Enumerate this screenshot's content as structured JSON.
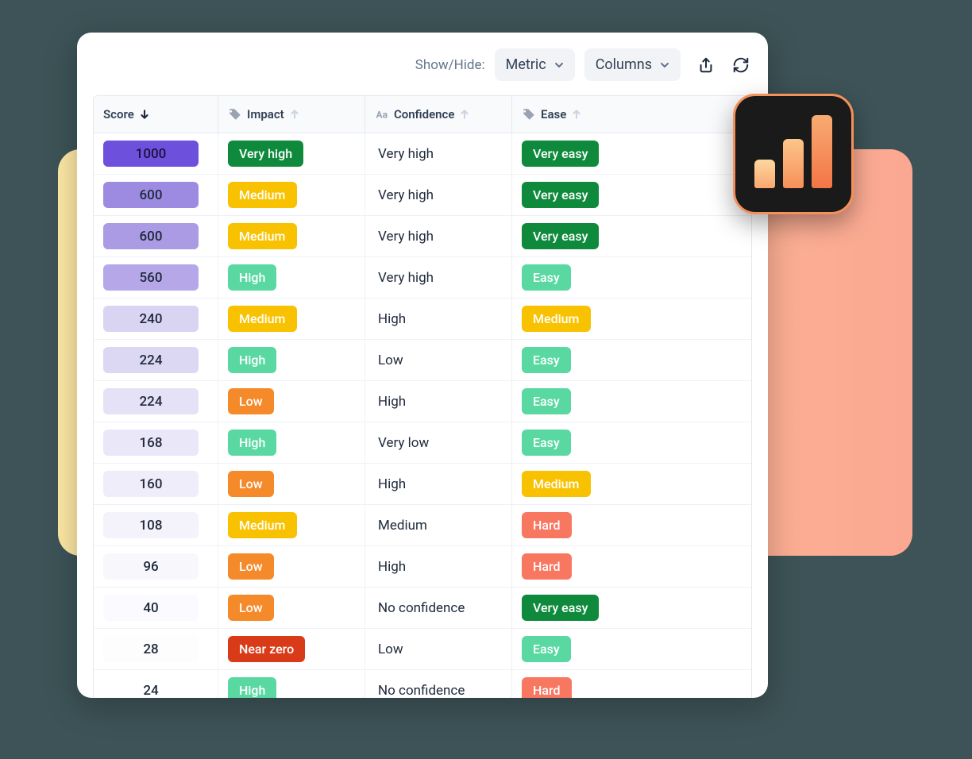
{
  "toolbar": {
    "showhide_label": "Show/Hide:",
    "metric_label": "Metric",
    "columns_label": "Columns"
  },
  "columns": {
    "score": "Score",
    "impact": "Impact",
    "confidence": "Confidence",
    "ease": "Ease"
  },
  "rows": [
    {
      "score": "1000",
      "impact": "Very high",
      "confidence": "Very high",
      "ease": "Very easy",
      "score_cls": "score-1",
      "impact_cls": "t-vhigh",
      "ease_cls": "t-veasy"
    },
    {
      "score": "600",
      "impact": "Medium",
      "confidence": "Very high",
      "ease": "Very easy",
      "score_cls": "score-2",
      "impact_cls": "t-med",
      "ease_cls": "t-veasy"
    },
    {
      "score": "600",
      "impact": "Medium",
      "confidence": "Very high",
      "ease": "Very easy",
      "score_cls": "score-3",
      "impact_cls": "t-med",
      "ease_cls": "t-veasy"
    },
    {
      "score": "560",
      "impact": "High",
      "confidence": "Very high",
      "ease": "Easy",
      "score_cls": "score-4",
      "impact_cls": "t-high",
      "ease_cls": "t-easy"
    },
    {
      "score": "240",
      "impact": "Medium",
      "confidence": "High",
      "ease": "Medium",
      "score_cls": "score-5",
      "impact_cls": "t-med",
      "ease_cls": "t-emed"
    },
    {
      "score": "224",
      "impact": "High",
      "confidence": "Low",
      "ease": "Easy",
      "score_cls": "score-6",
      "impact_cls": "t-high",
      "ease_cls": "t-easy"
    },
    {
      "score": "224",
      "impact": "Low",
      "confidence": "High",
      "ease": "Easy",
      "score_cls": "score-7",
      "impact_cls": "t-low",
      "ease_cls": "t-easy"
    },
    {
      "score": "168",
      "impact": "High",
      "confidence": "Very low",
      "ease": "Easy",
      "score_cls": "score-8",
      "impact_cls": "t-high",
      "ease_cls": "t-easy"
    },
    {
      "score": "160",
      "impact": "Low",
      "confidence": "High",
      "ease": "Medium",
      "score_cls": "score-9",
      "impact_cls": "t-low",
      "ease_cls": "t-emed"
    },
    {
      "score": "108",
      "impact": "Medium",
      "confidence": "Medium",
      "ease": "Hard",
      "score_cls": "score-10",
      "impact_cls": "t-med",
      "ease_cls": "t-hard"
    },
    {
      "score": "96",
      "impact": "Low",
      "confidence": "High",
      "ease": "Hard",
      "score_cls": "score-11",
      "impact_cls": "t-low",
      "ease_cls": "t-hard"
    },
    {
      "score": "40",
      "impact": "Low",
      "confidence": "No confidence",
      "ease": "Very easy",
      "score_cls": "score-12",
      "impact_cls": "t-low",
      "ease_cls": "t-veasy"
    },
    {
      "score": "28",
      "impact": "Near zero",
      "confidence": "Low",
      "ease": "Easy",
      "score_cls": "score-13",
      "impact_cls": "t-nzero",
      "ease_cls": "t-easy"
    },
    {
      "score": "24",
      "impact": "High",
      "confidence": "No confidence",
      "ease": "Hard",
      "score_cls": "score-14",
      "impact_cls": "t-high",
      "ease_cls": "t-hard"
    }
  ]
}
